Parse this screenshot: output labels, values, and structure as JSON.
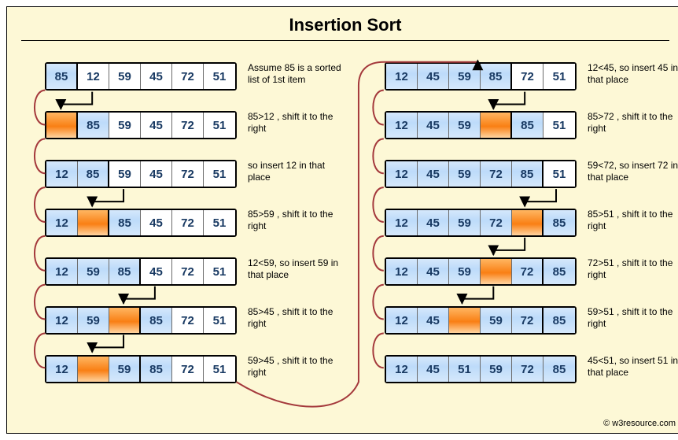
{
  "title": "Insertion   Sort",
  "credit": "© w3resource.com",
  "columns": {
    "left": [
      {
        "cells": [
          {
            "v": "85",
            "hl": true,
            "sep": true
          },
          {
            "v": "12"
          },
          {
            "v": "59"
          },
          {
            "v": "45"
          },
          {
            "v": "72"
          },
          {
            "v": "51"
          }
        ],
        "caption": "Assume 85 is a sorted list of 1st item"
      },
      {
        "cells": [
          {
            "v": "",
            "gap": true,
            "sep": true
          },
          {
            "v": "85",
            "hl": true
          },
          {
            "v": "59"
          },
          {
            "v": "45"
          },
          {
            "v": "72"
          },
          {
            "v": "51"
          }
        ],
        "caption": "85>12 , shift it to the right"
      },
      {
        "cells": [
          {
            "v": "12",
            "hl": true
          },
          {
            "v": "85",
            "hl": true,
            "sep": true
          },
          {
            "v": "59"
          },
          {
            "v": "45"
          },
          {
            "v": "72"
          },
          {
            "v": "51"
          }
        ],
        "caption": "so insert 12 in that place"
      },
      {
        "cells": [
          {
            "v": "12",
            "hl": true
          },
          {
            "v": "",
            "gap": true,
            "sep": true
          },
          {
            "v": "85",
            "hl": true
          },
          {
            "v": "45"
          },
          {
            "v": "72"
          },
          {
            "v": "51"
          }
        ],
        "caption": "85>59 , shift it to the right"
      },
      {
        "cells": [
          {
            "v": "12",
            "hl": true
          },
          {
            "v": "59",
            "hl": true
          },
          {
            "v": "85",
            "hl": true,
            "sep": true
          },
          {
            "v": "45"
          },
          {
            "v": "72"
          },
          {
            "v": "51"
          }
        ],
        "caption": "12<59, so insert 59 in that place"
      },
      {
        "cells": [
          {
            "v": "12",
            "hl": true
          },
          {
            "v": "59",
            "hl": true
          },
          {
            "v": "",
            "gap": true,
            "sep": true
          },
          {
            "v": "85",
            "hl": true
          },
          {
            "v": "72"
          },
          {
            "v": "51"
          }
        ],
        "caption": "85>45 , shift it to the right"
      },
      {
        "cells": [
          {
            "v": "12",
            "hl": true
          },
          {
            "v": "",
            "gap": true
          },
          {
            "v": "59",
            "hl": true,
            "sep": true
          },
          {
            "v": "85",
            "hl": true
          },
          {
            "v": "72"
          },
          {
            "v": "51"
          }
        ],
        "caption": "59>45 , shift it to the right"
      }
    ],
    "right": [
      {
        "cells": [
          {
            "v": "12",
            "hl": true
          },
          {
            "v": "45",
            "hl": true
          },
          {
            "v": "59",
            "hl": true
          },
          {
            "v": "85",
            "hl": true,
            "sep": true
          },
          {
            "v": "72"
          },
          {
            "v": "51"
          }
        ],
        "caption": "12<45, so insert 45 in that place"
      },
      {
        "cells": [
          {
            "v": "12",
            "hl": true
          },
          {
            "v": "45",
            "hl": true
          },
          {
            "v": "59",
            "hl": true
          },
          {
            "v": "",
            "gap": true,
            "sep": true
          },
          {
            "v": "85",
            "hl": true
          },
          {
            "v": "51"
          }
        ],
        "caption": "85>72 , shift it to the right"
      },
      {
        "cells": [
          {
            "v": "12",
            "hl": true
          },
          {
            "v": "45",
            "hl": true
          },
          {
            "v": "59",
            "hl": true
          },
          {
            "v": "72",
            "hl": true
          },
          {
            "v": "85",
            "hl": true,
            "sep": true
          },
          {
            "v": "51"
          }
        ],
        "caption": "59<72, so insert 72 in that place"
      },
      {
        "cells": [
          {
            "v": "12",
            "hl": true
          },
          {
            "v": "45",
            "hl": true
          },
          {
            "v": "59",
            "hl": true
          },
          {
            "v": "72",
            "hl": true
          },
          {
            "v": "",
            "gap": true,
            "sep": true
          },
          {
            "v": "85",
            "hl": true
          }
        ],
        "caption": "85>51 , shift it to the right"
      },
      {
        "cells": [
          {
            "v": "12",
            "hl": true
          },
          {
            "v": "45",
            "hl": true
          },
          {
            "v": "59",
            "hl": true
          },
          {
            "v": "",
            "gap": true
          },
          {
            "v": "72",
            "hl": true,
            "sep": true
          },
          {
            "v": "85",
            "hl": true
          }
        ],
        "caption": "72>51 , shift it to the right"
      },
      {
        "cells": [
          {
            "v": "12",
            "hl": true
          },
          {
            "v": "45",
            "hl": true
          },
          {
            "v": "",
            "gap": true
          },
          {
            "v": "59",
            "hl": true
          },
          {
            "v": "72",
            "hl": true,
            "sep": true
          },
          {
            "v": "85",
            "hl": true
          }
        ],
        "caption": "59>51 , shift it to the right"
      },
      {
        "cells": [
          {
            "v": "12",
            "hl": true
          },
          {
            "v": "45",
            "hl": true
          },
          {
            "v": "51",
            "hl": true
          },
          {
            "v": "59",
            "hl": true
          },
          {
            "v": "72",
            "hl": true
          },
          {
            "v": "85",
            "hl": true
          }
        ],
        "caption": "45<51, so insert 51 in that place"
      }
    ]
  }
}
